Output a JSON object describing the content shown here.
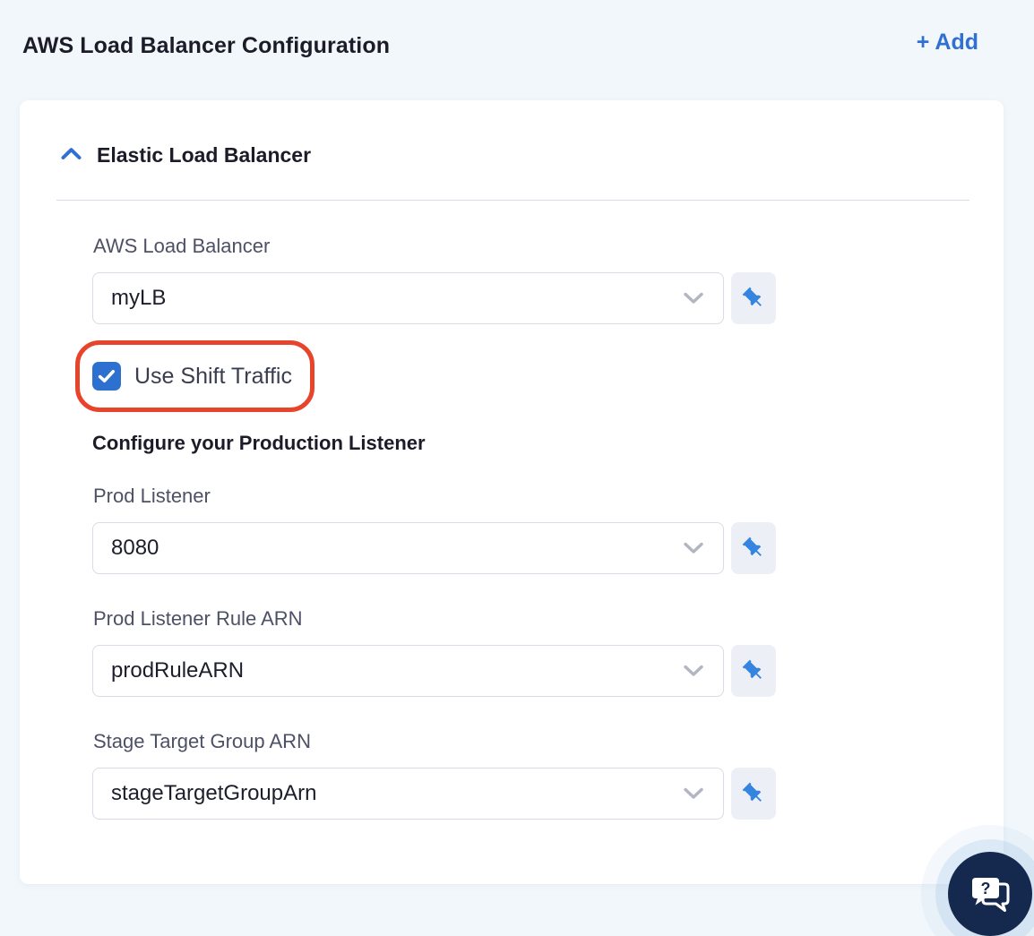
{
  "header": {
    "title": "AWS Load Balancer Configuration",
    "add_label": "+ Add"
  },
  "card": {
    "section_title": "Elastic Load Balancer",
    "fields": [
      {
        "label": "AWS Load Balancer",
        "value": "myLB"
      },
      {
        "label": "Prod Listener",
        "value": "8080"
      },
      {
        "label": "Prod Listener Rule ARN",
        "value": "prodRuleARN"
      },
      {
        "label": "Stage Target Group ARN",
        "value": "stageTargetGroupArn"
      }
    ],
    "checkbox": {
      "label": "Use Shift Traffic",
      "checked": true
    },
    "subheading": "Configure your Production Listener"
  },
  "icons": {
    "collapse": "chevron-up-icon",
    "dropdown": "chevron-down-icon",
    "pin": "pushpin-icon",
    "check": "checkmark-icon",
    "help": "chat-question-icon"
  },
  "colors": {
    "accent": "#2F70D2",
    "checkbox": "#2E70D0",
    "pin": "#3585E0",
    "annotation": "#E8442B",
    "chat": "#14294D",
    "page_bg": "#F2F7FB"
  }
}
